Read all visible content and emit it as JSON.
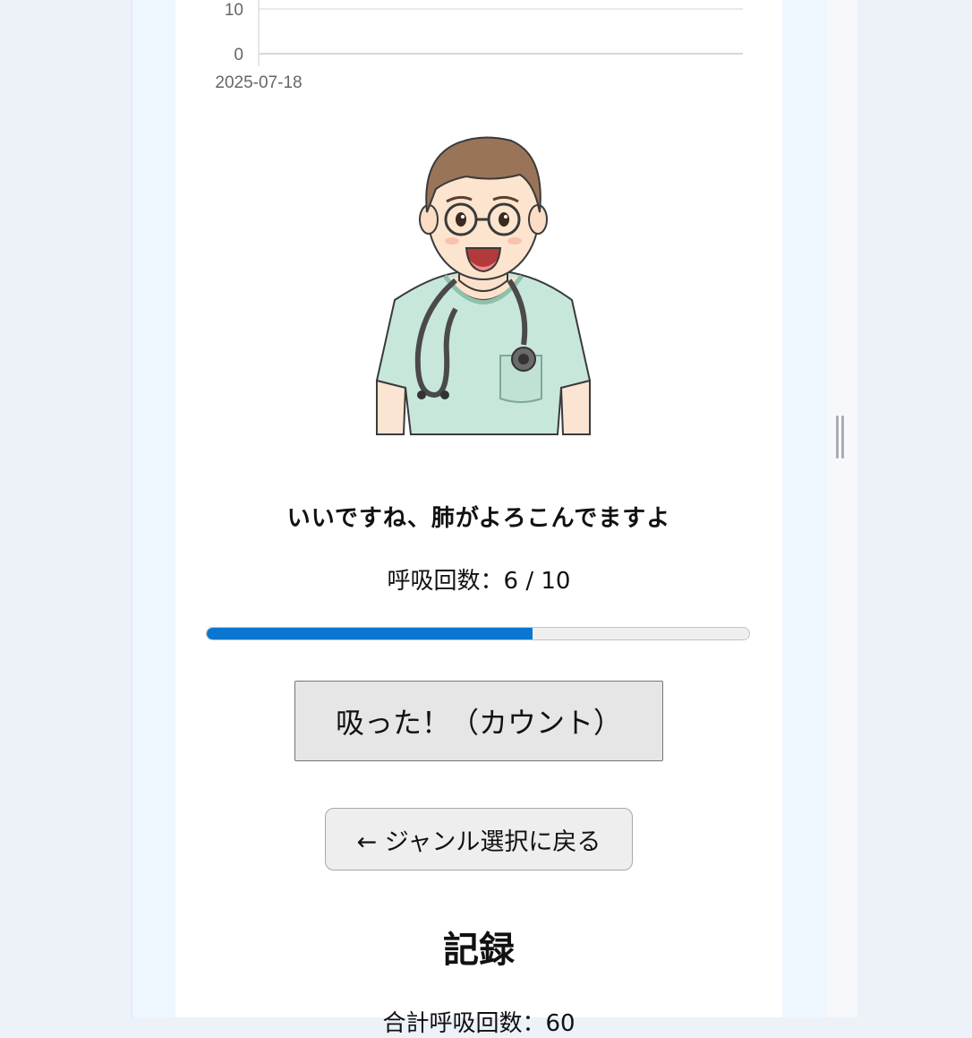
{
  "chart_data": {
    "type": "line",
    "x": [
      "2025-07-18"
    ],
    "xlabel": "",
    "ylabel": "",
    "y_ticks_visible": [
      "10",
      "0"
    ],
    "ylim": [
      0,
      10
    ],
    "grid": true,
    "series": []
  },
  "coach": {
    "image_label": "doctor-illustration",
    "message": "いいですね、肺がよろこんでますよ"
  },
  "counter": {
    "label": "呼吸回数",
    "separator": "：",
    "current": 6,
    "target": 10,
    "display": "呼吸回数：6 / 10",
    "progress_fraction": 0.6
  },
  "buttons": {
    "count_label": "吸った！（カウント）",
    "back_label": "← ジャンル選択に戻る"
  },
  "records": {
    "heading": "記録",
    "total_line": "合計呼吸回数：60"
  },
  "colors": {
    "progress": "#0a76d0",
    "page_background": "#edf1f8",
    "frame_background": "#eef6ff",
    "card_background": "#ffffff"
  }
}
